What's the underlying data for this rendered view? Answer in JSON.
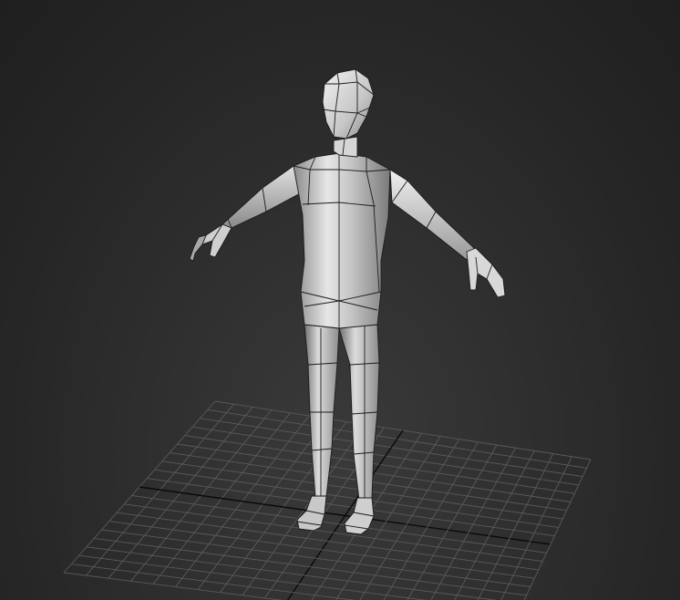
{
  "viewport": {
    "mode": "3d-perspective",
    "shading": "smooth-shaded-with-edged-faces",
    "background_color": "#2c2c2c",
    "grid_color": "#5a5a5a",
    "grid_axis_color": "#0a0a0a",
    "mesh_color": "#b8b8b8",
    "wire_color": "#1e1e1e"
  },
  "scene": {
    "objects": [
      {
        "name": "low-poly-humanoid-character",
        "pose": "T-pose"
      }
    ],
    "grid": {
      "visible": true,
      "home_grid": true
    }
  }
}
